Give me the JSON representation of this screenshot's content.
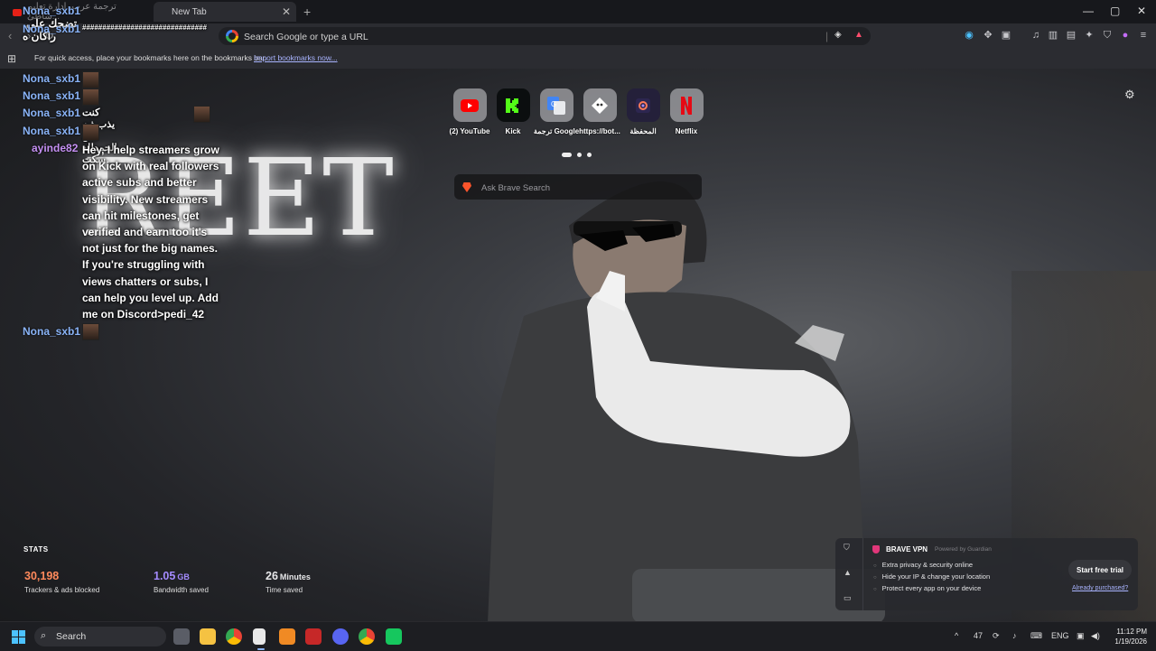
{
  "browser": {
    "tabs": [
      {
        "label": "ترجمة عرب، إدارة تعليم شاطئ...",
        "active": false
      },
      {
        "label": "New Tab",
        "active": true
      }
    ],
    "window_controls": [
      "—",
      "▢",
      "✕"
    ],
    "url_placeholder": "Search Google or type a URL",
    "bookmarks_message": "For quick access, place your bookmarks here on the bookmarks bar.",
    "bookmarks_link": "Import bookmarks now..."
  },
  "chat": {
    "messages": [
      {
        "user": "Nona_sxb1",
        "text": "تضحك علي راكان ه"
      },
      {
        "user": "Nona_sxb1",
        "text": "###############################"
      },
      {
        "user": "Nona_sxb1",
        "text": ""
      },
      {
        "user": "Nona_sxb1",
        "text": ""
      },
      {
        "user": "Nona_sxb1",
        "text": "كنت يذب ذبه بس الحمدلله سكت"
      },
      {
        "user": "Nona_sxb1",
        "text": ""
      },
      {
        "user": "ayinde82",
        "text": "Hey, I help streamers grow on Kick with real followers active subs and better visibility. New streamers can hit milestones, get verified and earn too it's not just for the big names. If you're struggling with views chatters or subs, I can help you level up. Add me on Discord>pedi_42"
      },
      {
        "user": "Nona_sxb1",
        "text": ""
      }
    ]
  },
  "background_word": "REET",
  "speed_dials": [
    {
      "label": "(2) YouTube",
      "icon": "youtube-icon",
      "color": "#ff0000"
    },
    {
      "label": "Kick",
      "icon": "kick-icon",
      "color": "#53fc18"
    },
    {
      "label": "ترجمة Google",
      "icon": "google-translate-icon",
      "color": "#4285f4"
    },
    {
      "label": "https://bot...",
      "icon": "bot-icon",
      "color": "#ffffff"
    },
    {
      "label": "المحفظة",
      "icon": "wallet-icon",
      "color": "#6c3bd1"
    },
    {
      "label": "Netflix",
      "icon": "netflix-icon",
      "color": "#e50914"
    }
  ],
  "search": {
    "placeholder": "Ask Brave Search"
  },
  "stats": {
    "title": "STATS",
    "items": [
      {
        "value": "30,198",
        "unit": "",
        "label": "Trackers & ads blocked",
        "color": "#ff8a5c"
      },
      {
        "value": "1.05",
        "unit": "GB",
        "label": "Bandwidth saved",
        "color": "#a48bff"
      },
      {
        "value": "26",
        "unit": "Minutes",
        "label": "Time saved",
        "color": "#ffffff"
      }
    ]
  },
  "vpn": {
    "title": "BRAVE VPN",
    "powered_by": "Powered by Guardian",
    "features": [
      "Extra privacy & security online",
      "Hide your IP & change your location",
      "Protect every app on your device"
    ],
    "cta": "Start free trial",
    "already": "Already purchased?"
  },
  "taskbar": {
    "search_label": "Search",
    "tray": {
      "badge": "47",
      "language": "ENG"
    },
    "time": "11:12 PM",
    "date": "1/19/2026"
  }
}
